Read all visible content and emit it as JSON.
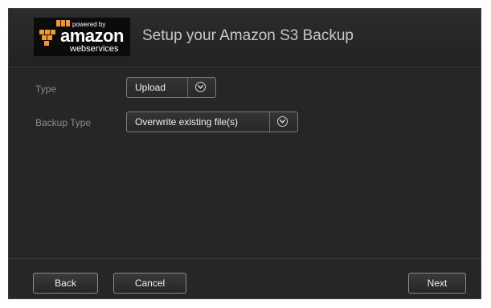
{
  "logo": {
    "powered_by": "powered by",
    "brand": "amazon",
    "sub": "webservices"
  },
  "header": {
    "title": "Setup your Amazon S3 Backup"
  },
  "form": {
    "type_label": "Type",
    "type_value": "Upload",
    "backup_type_label": "Backup Type",
    "backup_type_value": "Overwrite existing file(s)"
  },
  "footer": {
    "back_label": "Back",
    "cancel_label": "Cancel",
    "next_label": "Next"
  },
  "colors": {
    "background": "#262626",
    "logo_orange": "#f39a1e",
    "text_muted": "#8a8a8a"
  }
}
